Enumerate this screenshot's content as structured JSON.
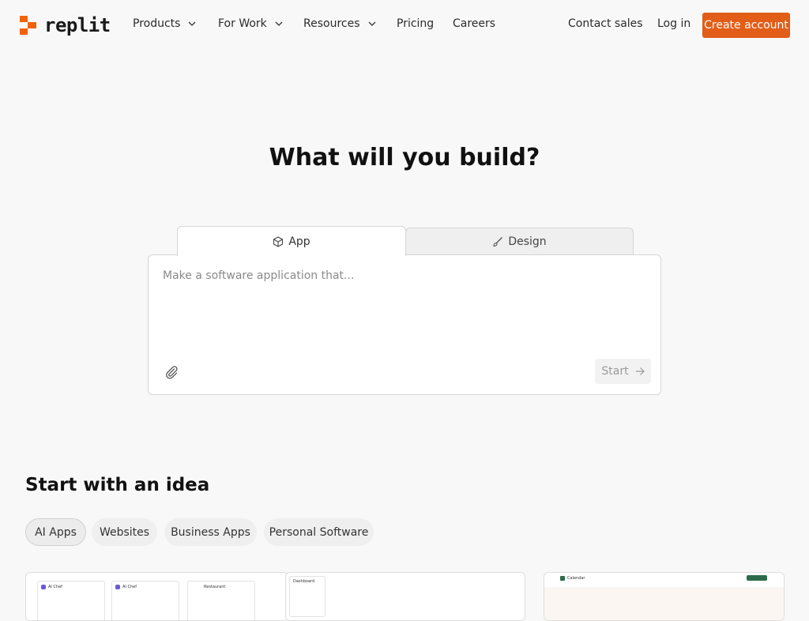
{
  "nav": {
    "logo_text": "replit",
    "items": [
      {
        "label": "Products",
        "dropdown": true
      },
      {
        "label": "For Work",
        "dropdown": true
      },
      {
        "label": "Resources",
        "dropdown": true
      },
      {
        "label": "Pricing",
        "dropdown": false
      },
      {
        "label": "Careers",
        "dropdown": false
      }
    ],
    "contact_sales": "Contact sales",
    "login": "Log in",
    "create_account": "Create account"
  },
  "hero": {
    "title": "What will you build?",
    "tabs": [
      {
        "label": "App",
        "icon": "cube-icon",
        "active": true
      },
      {
        "label": "Design",
        "icon": "brush-icon",
        "active": false
      }
    ],
    "prompt_placeholder": "Make a software application that...",
    "prompt_value": "",
    "start_label": "Start"
  },
  "ideas": {
    "title": "Start with an idea",
    "chips": [
      {
        "label": "AI Apps",
        "active": true
      },
      {
        "label": "Websites",
        "active": false
      },
      {
        "label": "Business Apps",
        "active": false
      },
      {
        "label": "Personal Software",
        "active": false
      }
    ],
    "cards": [
      {
        "labels": [
          "AI Chef",
          "AI Chef",
          "Restaurant"
        ]
      },
      {
        "labels": [
          "Dashboard"
        ]
      },
      {
        "labels": [
          "Calendar"
        ]
      }
    ]
  },
  "colors": {
    "accent": "#e25d18",
    "background": "#f8f8f8"
  }
}
